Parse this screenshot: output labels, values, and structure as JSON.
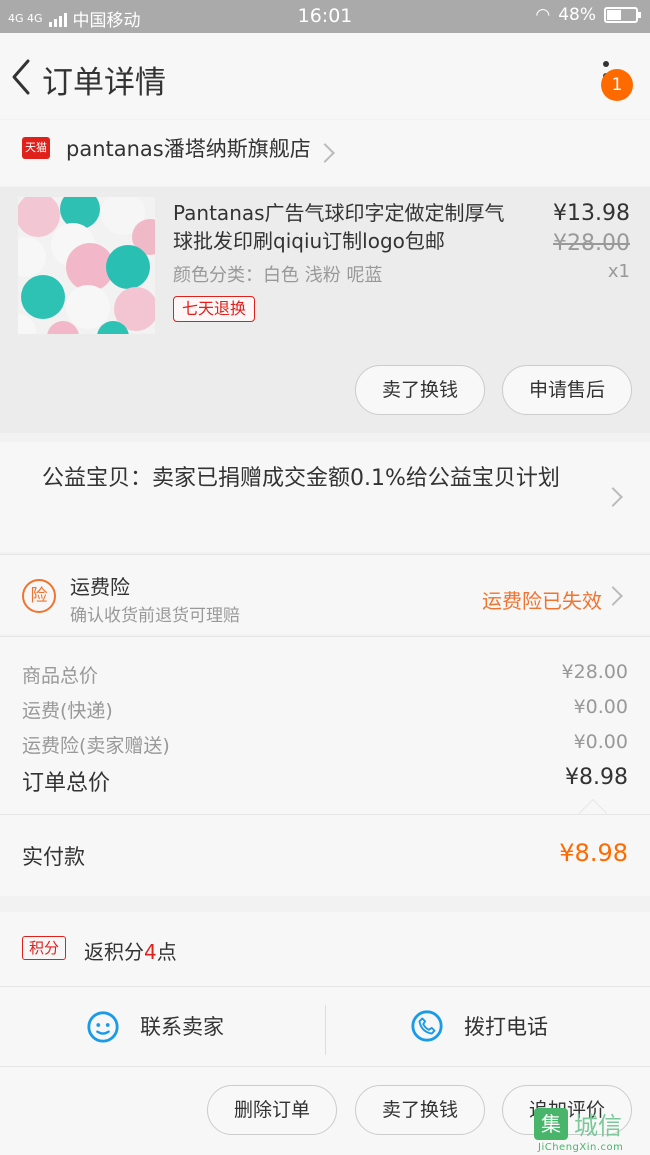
{
  "status_bar": {
    "network": "4G 4G",
    "carrier": "中国移动",
    "time": "16:01",
    "battery": "48%",
    "battery_level": 0.48
  },
  "header": {
    "title": "订单详情",
    "notification_count": "1"
  },
  "shop": {
    "platform_badge": "天猫",
    "name": "pantanas潘塔纳斯旗舰店"
  },
  "product": {
    "title": "Pantanas广告气球印字定做定制厚气球批发印刷qiqiu订制logo包邮",
    "variant": "颜色分类：白色 浅粉 呢蓝",
    "price": "¥13.98",
    "original_price": "¥28.00",
    "quantity": "x1",
    "return_tag": "七天退换",
    "buttons": [
      "卖了换钱",
      "申请售后"
    ]
  },
  "charity": {
    "text": "公益宝贝：卖家已捐赠成交金额0.1%给公益宝贝计划"
  },
  "insurance": {
    "icon_text": "险",
    "title": "运费险",
    "subtitle": "确认收货前退货可理赔",
    "status": "运费险已失效"
  },
  "totals": {
    "rows": [
      {
        "label": "商品总价",
        "value": "¥28.00"
      },
      {
        "label": "运费(快递)",
        "value": "¥0.00"
      },
      {
        "label": "运费险(卖家赠送)",
        "value": "¥0.00"
      }
    ],
    "order_total_label": "订单总价",
    "order_total_value": "¥8.98"
  },
  "paid": {
    "label": "实付款",
    "value": "¥8.98"
  },
  "points": {
    "badge": "积分",
    "text_before": "返积分",
    "count": "4",
    "text_after": "点"
  },
  "contact": {
    "seller_label": "联系卖家",
    "phone_label": "拨打电话"
  },
  "bottom_actions": [
    "删除订单",
    "卖了换钱",
    "追加评价"
  ],
  "watermark": {
    "mark": "集",
    "title": "城信",
    "site": "JiChengXin.com"
  },
  "colors": {
    "accent_orange": "#ff6a00",
    "tmall_red": "#e0201b",
    "contact_blue": "#1a9be8"
  }
}
